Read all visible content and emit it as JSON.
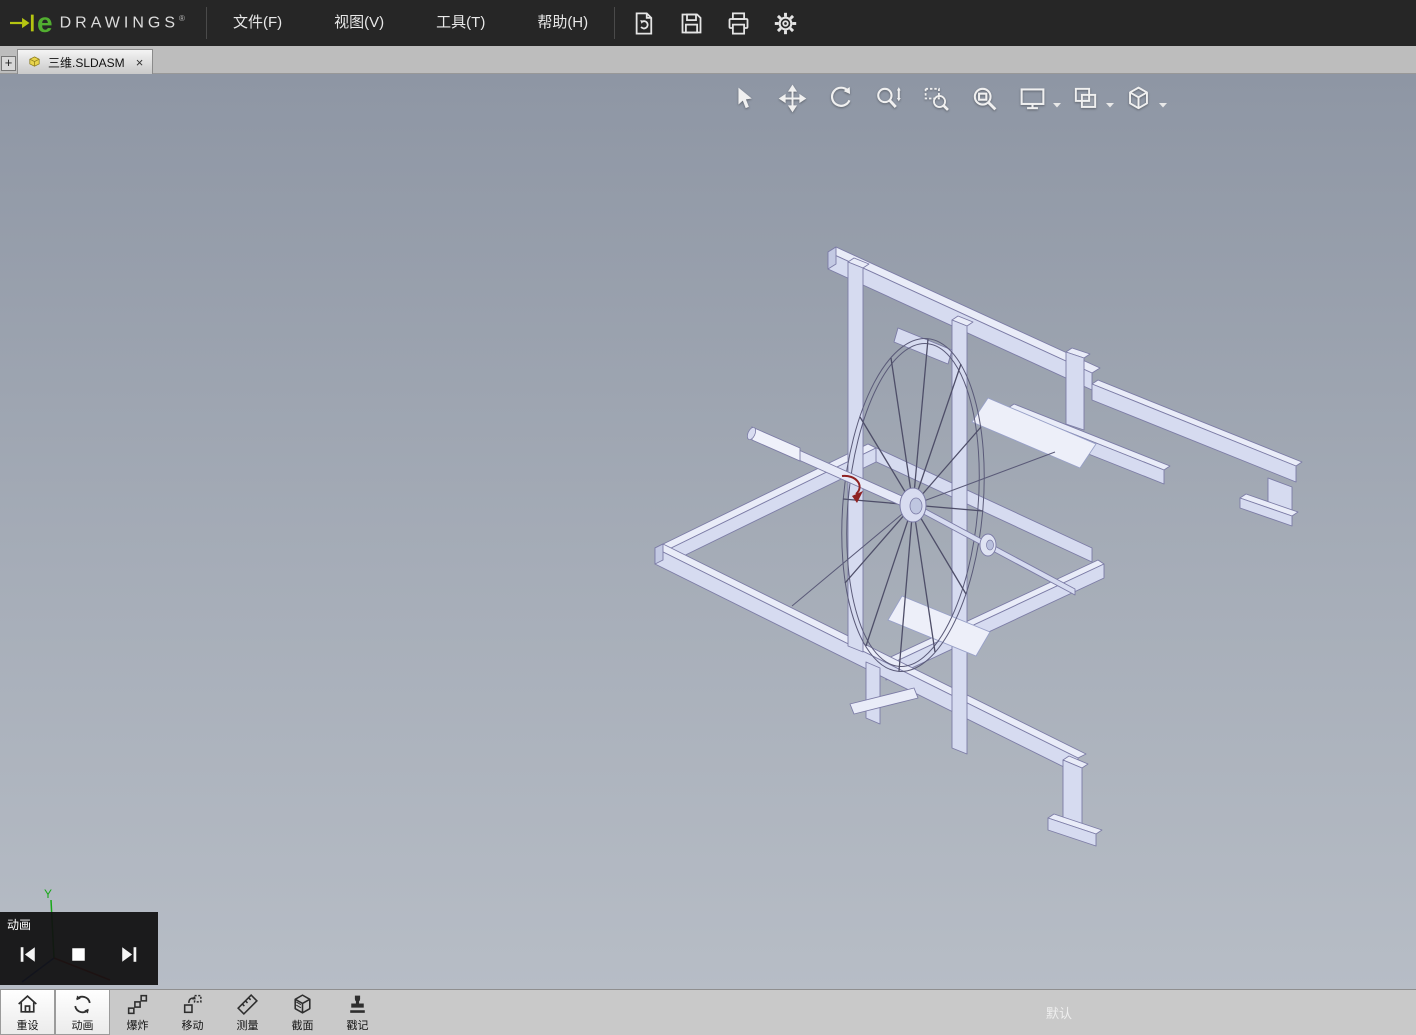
{
  "header": {
    "logo": {
      "brand_e": "e",
      "brand_rest": "DRAWINGS",
      "registered": "®"
    },
    "menus": [
      {
        "label": "文件(F)"
      },
      {
        "label": "视图(V)"
      },
      {
        "label": "工具(T)"
      },
      {
        "label": "帮助(H)"
      }
    ],
    "actions": [
      {
        "id": "open",
        "icon": "open-icon"
      },
      {
        "id": "save",
        "icon": "save-icon"
      },
      {
        "id": "print",
        "icon": "print-icon"
      },
      {
        "id": "settings",
        "icon": "gear-icon"
      }
    ]
  },
  "tab_bar": {
    "new_tab_label": "+",
    "tabs": [
      {
        "label": "三维.SLDASM",
        "close_label": "×",
        "active": true
      }
    ]
  },
  "viewport_toolbar": {
    "tools": [
      {
        "id": "select"
      },
      {
        "id": "pan"
      },
      {
        "id": "rotate"
      },
      {
        "id": "zoom"
      },
      {
        "id": "zoom-area"
      },
      {
        "id": "zoom-fit"
      },
      {
        "id": "fullscreen",
        "has_dropdown": true
      },
      {
        "id": "display-style",
        "has_dropdown": true
      },
      {
        "id": "view-orientation",
        "has_dropdown": true
      }
    ]
  },
  "animation_panel": {
    "title": "动画",
    "controls": [
      "skip-start",
      "stop",
      "skip-end"
    ]
  },
  "triad": {
    "y_label": "Y"
  },
  "bottom_toolbar": {
    "items": [
      {
        "label": "重设",
        "active": true
      },
      {
        "label": "动画",
        "active": true
      },
      {
        "label": "爆炸",
        "active": false
      },
      {
        "label": "移动",
        "active": false
      },
      {
        "label": "测量",
        "active": false
      },
      {
        "label": "截面",
        "active": false
      },
      {
        "label": "戳记",
        "active": false
      }
    ],
    "configuration": "默认"
  },
  "colors": {
    "header_bg": "#262626",
    "logo_green": "#52ae30",
    "logo_arrow_yellow": "#b5c511",
    "tab_bar_bg": "#bdbdbd",
    "viewport_gradient_top": "#8e96a4",
    "viewport_gradient_bottom": "#b7bdc6",
    "model_face_light": "#e9ecf8",
    "model_face_mid": "#d6dbf0",
    "model_edge": "#7c7ca6",
    "bottom_bar_bg": "#c9c9c9",
    "animation_panel_bg": "#111111",
    "triad_y_green": "#18a818"
  }
}
